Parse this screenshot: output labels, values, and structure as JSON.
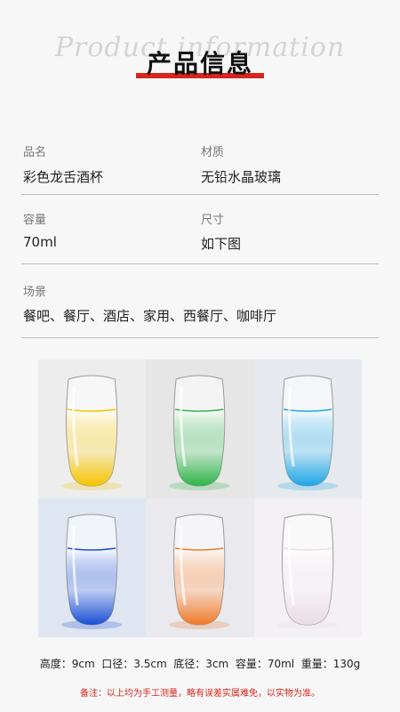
{
  "header": {
    "script_text": "Product information",
    "title": "产品信息"
  },
  "specs": [
    {
      "label": "品名",
      "value": "彩色龙舌酒杯"
    },
    {
      "label": "材质",
      "value": "无铅水晶玻璃"
    },
    {
      "label": "容量",
      "value": "70ml"
    },
    {
      "label": "尺寸",
      "value": "如下图"
    },
    {
      "label": "场景",
      "value": "餐吧、餐厅、酒店、家用、西餐厅、咖啡厅"
    }
  ],
  "gallery": {
    "items": [
      {
        "color": "#f5c400",
        "background": "#ededed"
      },
      {
        "color": "#2fb449",
        "background": "#e6e6e6"
      },
      {
        "color": "#1da6e6",
        "background": "#e6eaee"
      },
      {
        "color": "#1b4fd6",
        "background": "#dfe6f1"
      },
      {
        "color": "#f07a2a",
        "background": "#e9e9ee"
      },
      {
        "color": "#e8dce4",
        "background": "#f3f1f4"
      }
    ]
  },
  "dimensions": "高度：9cm  口径：3.5cm  底径：3cm  容量：70ml  重量：130g",
  "note": "备注：以上均为手工测量，略有误差实属难免，以实物为准。",
  "colors": {
    "accent": "#d7261e",
    "rule": "#bdbdbd",
    "background": "#f7f7f7"
  }
}
